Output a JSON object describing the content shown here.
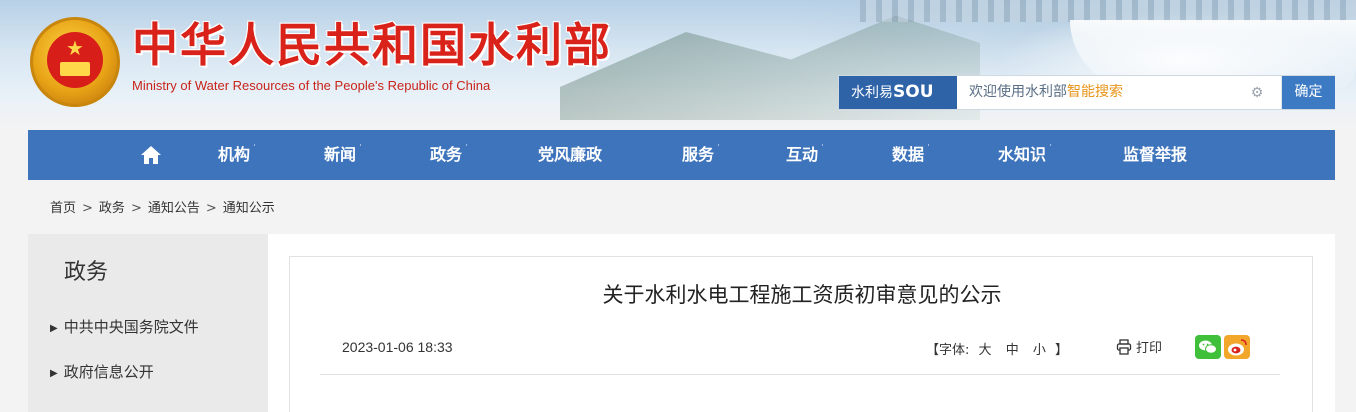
{
  "header": {
    "title": "中华人民共和国水利部",
    "subtitle": "Ministry of Water Resources of the People's Republic of China",
    "emblem_icon": "national-emblem-icon"
  },
  "search": {
    "brand_prefix": "水利易",
    "brand_sou": "SOU",
    "placeholder_main": "欢迎使用水利部",
    "placeholder_accent": "智能搜索",
    "confirm_label": "确定",
    "brand_color": "#2e63a8",
    "accent_color": "#e8941a"
  },
  "nav": {
    "background": "#3d74bb",
    "home_icon": "home-icon",
    "items": [
      {
        "label": "机构",
        "dropdown": true
      },
      {
        "label": "新闻",
        "dropdown": true
      },
      {
        "label": "政务",
        "dropdown": true
      },
      {
        "label": "党风廉政",
        "dropdown": false
      },
      {
        "label": "服务",
        "dropdown": true
      },
      {
        "label": "互动",
        "dropdown": true
      },
      {
        "label": "数据",
        "dropdown": true
      },
      {
        "label": "水知识",
        "dropdown": true
      },
      {
        "label": "监督举报",
        "dropdown": false
      }
    ],
    "dropdown_marker": "˙"
  },
  "breadcrumb": {
    "items": [
      "首页",
      "政务",
      "通知公告",
      "通知公示"
    ],
    "separator": ">"
  },
  "sidebar": {
    "title": "政务",
    "items": [
      "中共中央国务院文件",
      "政府信息公开"
    ],
    "arrow": "▶"
  },
  "article": {
    "title": "关于水利水电工程施工资质初审意见的公示",
    "date": "2023-01-06 18:33",
    "font_label_open": "【字体:",
    "font_large": "大",
    "font_medium": "中",
    "font_small": "小",
    "font_label_close": "】",
    "print_label": "打印",
    "share_wechat_icon": "wechat-icon",
    "share_weibo_icon": "weibo-icon"
  }
}
